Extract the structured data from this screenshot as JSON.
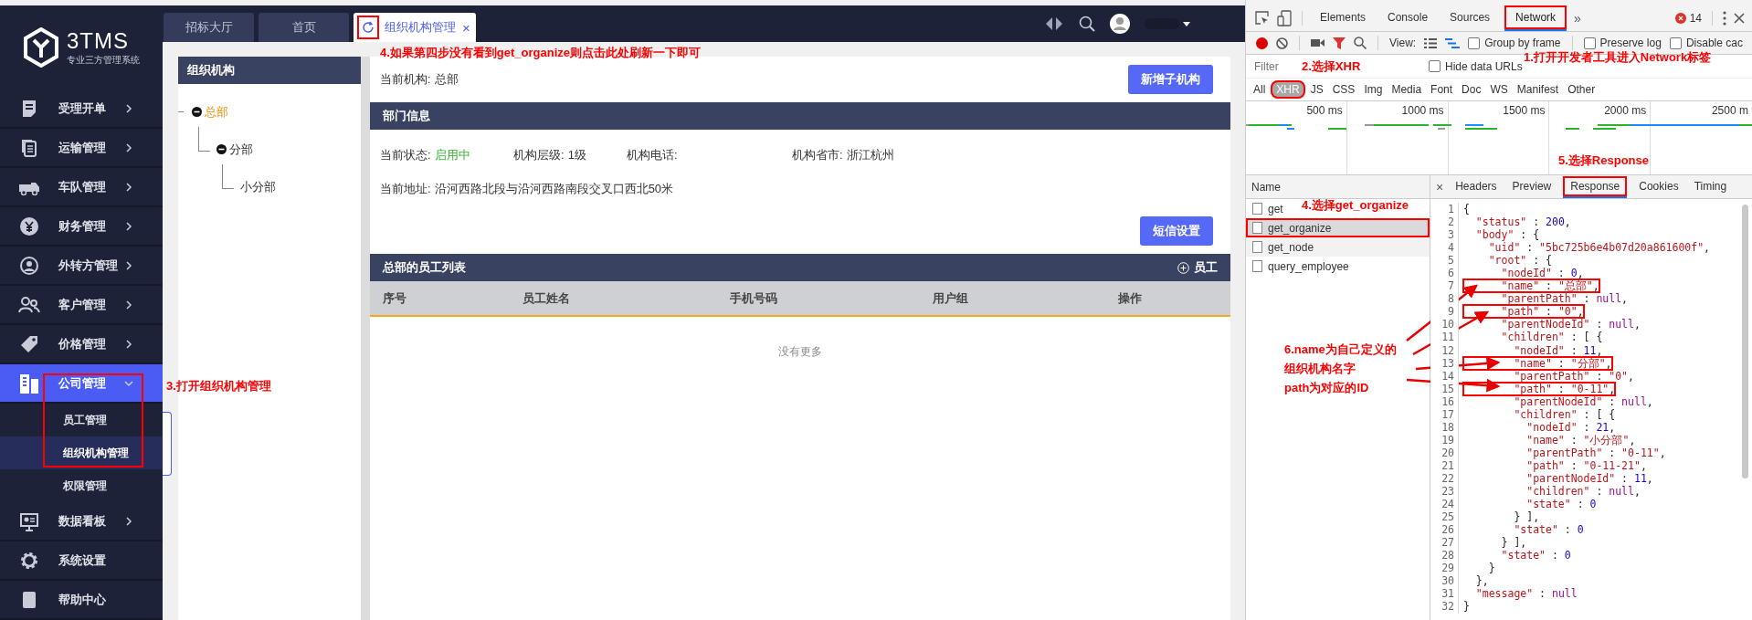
{
  "sidebar": {
    "logo": {
      "name": "3TMS",
      "tagline": "专业三方管理系统"
    },
    "items": [
      {
        "label": "受理开单",
        "kind": "group",
        "expanded": false,
        "selected": false,
        "boxed": false
      },
      {
        "label": "运输管理",
        "kind": "group",
        "expanded": false,
        "selected": false,
        "boxed": false
      },
      {
        "label": "车队管理",
        "kind": "group",
        "expanded": false,
        "selected": false,
        "boxed": false
      },
      {
        "label": "财务管理",
        "kind": "group",
        "expanded": false,
        "selected": false,
        "boxed": false
      },
      {
        "label": "外转方管理",
        "kind": "group",
        "expanded": false,
        "selected": false,
        "boxed": false
      },
      {
        "label": "客户管理",
        "kind": "group",
        "expanded": false,
        "selected": false,
        "boxed": false
      },
      {
        "label": "价格管理",
        "kind": "group",
        "expanded": false,
        "selected": false,
        "boxed": false
      },
      {
        "label": "公司管理",
        "kind": "group",
        "expanded": true,
        "selected": true,
        "boxed": true,
        "children": [
          {
            "label": "员工管理",
            "selected": false
          },
          {
            "label": "组织机构管理",
            "selected": true
          },
          {
            "label": "权限管理",
            "selected": false
          }
        ]
      },
      {
        "label": "数据看板",
        "kind": "group",
        "expanded": false,
        "selected": false,
        "boxed": false
      },
      {
        "label": "系统设置",
        "kind": "link",
        "expanded": false,
        "selected": false,
        "boxed": false
      },
      {
        "label": "帮助中心",
        "kind": "link",
        "expanded": false,
        "selected": false,
        "boxed": false
      }
    ]
  },
  "topbar": {
    "tabs": [
      {
        "label": "招标大厅",
        "selected": false,
        "boxed": false
      },
      {
        "label": "首页",
        "selected": false,
        "boxed": false
      },
      {
        "label": "组织机构管理",
        "selected": true,
        "boxed": true
      }
    ],
    "close": "×"
  },
  "org_panel": {
    "title": "组织机构",
    "tree": [
      {
        "label": "总部",
        "selected": true,
        "expanded": true,
        "children": [
          {
            "label": "分部",
            "selected": false,
            "expanded": true,
            "children": [
              {
                "label": "小分部",
                "selected": false
              }
            ]
          }
        ]
      }
    ]
  },
  "detail": {
    "current_org": {
      "label": "当前机构:",
      "value": "总部"
    },
    "add_button": "新增子机构",
    "section_title": "部门信息",
    "fields": [
      {
        "label": "当前状态:",
        "value": "启用中",
        "kind": "status"
      },
      {
        "label": "机构层级:",
        "value": "1级",
        "kind": "text"
      },
      {
        "label": "机构电话:"
      },
      {
        "label": "机构省市:",
        "value": "浙江杭州",
        "kind": "text"
      }
    ],
    "address": {
      "label": "当前地址:",
      "value": "沿河西路北段与沿河西路南段交叉口西北50米"
    },
    "sms_button": "短信设置",
    "employees": {
      "title": "总部的员工列表",
      "add": "员工",
      "columns": [
        "序号",
        "员工姓名",
        "手机号码",
        "用户组",
        "操作"
      ],
      "empty": "没有更多"
    }
  },
  "devtools": {
    "tabs": [
      {
        "label": "Elements",
        "selected": false,
        "boxed": false
      },
      {
        "label": "Console",
        "selected": false,
        "boxed": false
      },
      {
        "label": "Sources",
        "selected": false,
        "boxed": false
      },
      {
        "label": "Network",
        "selected": true,
        "boxed": true
      }
    ],
    "more": "»",
    "error_count": "14",
    "view_label": "View:",
    "checkboxes": [
      {
        "label": "Group by frame",
        "checked": false
      },
      {
        "label": "Preserve log",
        "checked": false
      },
      {
        "label": "Disable cac",
        "checked": false
      }
    ],
    "filter": {
      "placeholder": "Filter"
    },
    "hide_data_urls": {
      "label": "Hide data URLs",
      "checked": false
    },
    "types": [
      {
        "label": "All",
        "selected": false,
        "boxed": false
      },
      {
        "label": "XHR",
        "selected": true,
        "boxed": true
      },
      {
        "label": "JS",
        "selected": false,
        "boxed": false
      },
      {
        "label": "CSS",
        "selected": false,
        "boxed": false
      },
      {
        "label": "Img",
        "selected": false,
        "boxed": false
      },
      {
        "label": "Media",
        "selected": false,
        "boxed": false
      },
      {
        "label": "Font",
        "selected": false,
        "boxed": false
      },
      {
        "label": "Doc",
        "selected": false,
        "boxed": false
      },
      {
        "label": "WS",
        "selected": false,
        "boxed": false
      },
      {
        "label": "Manifest",
        "selected": false,
        "boxed": false
      },
      {
        "label": "Other",
        "selected": false,
        "boxed": false
      }
    ],
    "timeline": {
      "ticks": [
        "500 ms",
        "1000 ms",
        "1500 ms",
        "2000 ms",
        "2500 m"
      ]
    },
    "requests": {
      "header": "Name",
      "items": [
        {
          "name": "get",
          "selected": false,
          "hovered": false,
          "boxed": false
        },
        {
          "name": "get_organize",
          "selected": true,
          "hovered": false,
          "boxed": true
        },
        {
          "name": "get_node",
          "selected": false,
          "hovered": true,
          "boxed": false
        },
        {
          "name": "query_employee",
          "selected": false,
          "hovered": false,
          "boxed": false
        }
      ]
    },
    "detail_close": "×",
    "detail_tabs": [
      {
        "label": "Headers",
        "selected": false,
        "boxed": false
      },
      {
        "label": "Preview",
        "selected": false,
        "boxed": false
      },
      {
        "label": "Response",
        "selected": true,
        "boxed": true
      },
      {
        "label": "Cookies",
        "selected": false,
        "boxed": false
      },
      {
        "label": "Timing",
        "selected": false,
        "boxed": false
      }
    ],
    "response_lines": [
      {
        "no": "1",
        "boxed": false,
        "parts": [
          {
            "kind": "punct",
            "text": "{"
          }
        ]
      },
      {
        "no": "2",
        "boxed": false,
        "parts": [
          {
            "kind": "key",
            "text": "  \"status\""
          },
          {
            "kind": "punct",
            "text": " : "
          },
          {
            "kind": "number",
            "text": "200"
          },
          {
            "kind": "punct",
            "text": ","
          }
        ]
      },
      {
        "no": "3",
        "boxed": false,
        "parts": [
          {
            "kind": "key",
            "text": "  \"body\""
          },
          {
            "kind": "punct",
            "text": " : {"
          }
        ]
      },
      {
        "no": "4",
        "boxed": false,
        "parts": [
          {
            "kind": "key",
            "text": "    \"uid\""
          },
          {
            "kind": "punct",
            "text": " : "
          },
          {
            "kind": "string",
            "text": "\"5bc725b6e4b07d20a861600f\""
          },
          {
            "kind": "punct",
            "text": ","
          }
        ]
      },
      {
        "no": "5",
        "boxed": false,
        "parts": [
          {
            "kind": "key",
            "text": "    \"root\""
          },
          {
            "kind": "punct",
            "text": " : {"
          }
        ]
      },
      {
        "no": "6",
        "boxed": false,
        "parts": [
          {
            "kind": "key",
            "text": "      \"nodeId\""
          },
          {
            "kind": "punct",
            "text": " : "
          },
          {
            "kind": "number",
            "text": "0"
          },
          {
            "kind": "punct",
            "text": ","
          }
        ]
      },
      {
        "no": "7",
        "boxed": true,
        "parts": [
          {
            "kind": "key",
            "text": "      \"name\""
          },
          {
            "kind": "punct",
            "text": " : "
          },
          {
            "kind": "string",
            "text": "\"总部\""
          },
          {
            "kind": "punct",
            "text": ","
          }
        ]
      },
      {
        "no": "8",
        "boxed": false,
        "parts": [
          {
            "kind": "key",
            "text": "      \"parentPath\""
          },
          {
            "kind": "punct",
            "text": " : "
          },
          {
            "kind": "null",
            "text": "null"
          },
          {
            "kind": "punct",
            "text": ","
          }
        ]
      },
      {
        "no": "9",
        "boxed": true,
        "parts": [
          {
            "kind": "key",
            "text": "      \"path\""
          },
          {
            "kind": "punct",
            "text": " : "
          },
          {
            "kind": "string",
            "text": "\"0\""
          },
          {
            "kind": "punct",
            "text": ","
          }
        ]
      },
      {
        "no": "10",
        "boxed": false,
        "parts": [
          {
            "kind": "key",
            "text": "      \"parentNodeId\""
          },
          {
            "kind": "punct",
            "text": " : "
          },
          {
            "kind": "null",
            "text": "null"
          },
          {
            "kind": "punct",
            "text": ","
          }
        ]
      },
      {
        "no": "11",
        "boxed": false,
        "parts": [
          {
            "kind": "key",
            "text": "      \"children\""
          },
          {
            "kind": "punct",
            "text": " : [ {"
          }
        ]
      },
      {
        "no": "12",
        "boxed": false,
        "parts": [
          {
            "kind": "key",
            "text": "        \"nodeId\""
          },
          {
            "kind": "punct",
            "text": " : "
          },
          {
            "kind": "number",
            "text": "11"
          },
          {
            "kind": "punct",
            "text": ","
          }
        ]
      },
      {
        "no": "13",
        "boxed": true,
        "parts": [
          {
            "kind": "key",
            "text": "        \"name\""
          },
          {
            "kind": "punct",
            "text": " : "
          },
          {
            "kind": "string",
            "text": "\"分部\""
          },
          {
            "kind": "punct",
            "text": ","
          }
        ]
      },
      {
        "no": "14",
        "boxed": false,
        "parts": [
          {
            "kind": "key",
            "text": "        \"parentPath\""
          },
          {
            "kind": "punct",
            "text": " : "
          },
          {
            "kind": "string",
            "text": "\"0\""
          },
          {
            "kind": "punct",
            "text": ","
          }
        ]
      },
      {
        "no": "15",
        "boxed": true,
        "parts": [
          {
            "kind": "key",
            "text": "        \"path\""
          },
          {
            "kind": "punct",
            "text": " : "
          },
          {
            "kind": "string",
            "text": "\"0-11\""
          },
          {
            "kind": "punct",
            "text": ","
          }
        ]
      },
      {
        "no": "16",
        "boxed": false,
        "parts": [
          {
            "kind": "key",
            "text": "        \"parentNodeId\""
          },
          {
            "kind": "punct",
            "text": " : "
          },
          {
            "kind": "null",
            "text": "null"
          },
          {
            "kind": "punct",
            "text": ","
          }
        ]
      },
      {
        "no": "17",
        "boxed": false,
        "parts": [
          {
            "kind": "key",
            "text": "        \"children\""
          },
          {
            "kind": "punct",
            "text": " : [ {"
          }
        ]
      },
      {
        "no": "18",
        "boxed": false,
        "parts": [
          {
            "kind": "key",
            "text": "          \"nodeId\""
          },
          {
            "kind": "punct",
            "text": " : "
          },
          {
            "kind": "number",
            "text": "21"
          },
          {
            "kind": "punct",
            "text": ","
          }
        ]
      },
      {
        "no": "19",
        "boxed": false,
        "parts": [
          {
            "kind": "key",
            "text": "          \"name\""
          },
          {
            "kind": "punct",
            "text": " : "
          },
          {
            "kind": "string",
            "text": "\"小分部\""
          },
          {
            "kind": "punct",
            "text": ","
          }
        ]
      },
      {
        "no": "20",
        "boxed": false,
        "parts": [
          {
            "kind": "key",
            "text": "          \"parentPath\""
          },
          {
            "kind": "punct",
            "text": " : "
          },
          {
            "kind": "string",
            "text": "\"0-11\""
          },
          {
            "kind": "punct",
            "text": ","
          }
        ]
      },
      {
        "no": "21",
        "boxed": false,
        "parts": [
          {
            "kind": "key",
            "text": "          \"path\""
          },
          {
            "kind": "punct",
            "text": " : "
          },
          {
            "kind": "string",
            "text": "\"0-11-21\""
          },
          {
            "kind": "punct",
            "text": ","
          }
        ]
      },
      {
        "no": "22",
        "boxed": false,
        "parts": [
          {
            "kind": "key",
            "text": "          \"parentNodeId\""
          },
          {
            "kind": "punct",
            "text": " : "
          },
          {
            "kind": "number",
            "text": "11"
          },
          {
            "kind": "punct",
            "text": ","
          }
        ]
      },
      {
        "no": "23",
        "boxed": false,
        "parts": [
          {
            "kind": "key",
            "text": "          \"children\""
          },
          {
            "kind": "punct",
            "text": " : "
          },
          {
            "kind": "null",
            "text": "null"
          },
          {
            "kind": "punct",
            "text": ","
          }
        ]
      },
      {
        "no": "24",
        "boxed": false,
        "parts": [
          {
            "kind": "key",
            "text": "          \"state\""
          },
          {
            "kind": "punct",
            "text": " : "
          },
          {
            "kind": "number",
            "text": "0"
          }
        ]
      },
      {
        "no": "25",
        "boxed": false,
        "parts": [
          {
            "kind": "punct",
            "text": "        } ],"
          }
        ]
      },
      {
        "no": "26",
        "boxed": false,
        "parts": [
          {
            "kind": "key",
            "text": "        \"state\""
          },
          {
            "kind": "punct",
            "text": " : "
          },
          {
            "kind": "number",
            "text": "0"
          }
        ]
      },
      {
        "no": "27",
        "boxed": false,
        "parts": [
          {
            "kind": "punct",
            "text": "      } ],"
          }
        ]
      },
      {
        "no": "28",
        "boxed": false,
        "parts": [
          {
            "kind": "key",
            "text": "      \"state\""
          },
          {
            "kind": "punct",
            "text": " : "
          },
          {
            "kind": "number",
            "text": "0"
          }
        ]
      },
      {
        "no": "29",
        "boxed": false,
        "parts": [
          {
            "kind": "punct",
            "text": "    }"
          }
        ]
      },
      {
        "no": "30",
        "boxed": false,
        "parts": [
          {
            "kind": "punct",
            "text": "  },"
          }
        ]
      },
      {
        "no": "31",
        "boxed": false,
        "parts": [
          {
            "kind": "key",
            "text": "  \"message\""
          },
          {
            "kind": "punct",
            "text": " : "
          },
          {
            "kind": "null",
            "text": "null"
          }
        ]
      },
      {
        "no": "32",
        "boxed": false,
        "parts": [
          {
            "kind": "punct",
            "text": "}"
          }
        ]
      }
    ]
  },
  "annotations": [
    {
      "kind": "refresh",
      "lines": [
        "4.如果第四步没有看到get_organize则点击此处刷新一下即可"
      ]
    },
    {
      "kind": "sidebar",
      "lines": [
        "3.打开组织机构管理"
      ]
    },
    {
      "kind": "network",
      "lines": [
        "1.打开开发者工具进入Network标签"
      ]
    },
    {
      "kind": "xhr",
      "lines": [
        "2.选择XHR"
      ]
    },
    {
      "kind": "response",
      "lines": [
        "5.选择Response"
      ]
    },
    {
      "kind": "requests",
      "lines": [
        "4.选择get_organize"
      ]
    },
    {
      "kind": "code",
      "lines": [
        "6.name为自己定义的",
        "组织机构名字",
        "path为对应的ID"
      ]
    }
  ]
}
